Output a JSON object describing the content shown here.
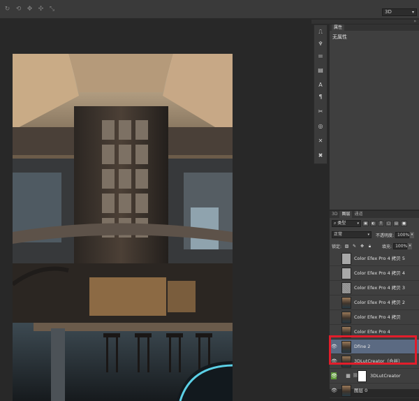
{
  "toolbar": {
    "icons": [
      "orbit-3d-icon",
      "roll-3d-icon",
      "pan-3d-icon",
      "slide-3d-icon",
      "scale-3d-icon"
    ],
    "mode_select": "3D"
  },
  "tool_strip": {
    "icons": [
      "history-brush-icon",
      "character-icon",
      "properties-sliders-icon",
      "adjust-icon",
      "text-icon",
      "paragraph-icon",
      "transform-icon",
      "path-icon",
      "tool-x-icon",
      "cross-tools-icon"
    ]
  },
  "properties_panel": {
    "tab_label": "属性",
    "title": "无属性"
  },
  "layers_panel": {
    "tabs": [
      "3D",
      "图层",
      "通道"
    ],
    "active_tab": "图层",
    "kind_filter": "类型",
    "blend_mode": "正常",
    "opacity_label": "不透明度:",
    "opacity_value": "100%",
    "lock_label": "锁定:",
    "fill_label": "填充:",
    "fill_value": "100%",
    "layers": [
      {
        "name": "Color Efex Pro 4 拷贝 5",
        "visible": false,
        "thumb": "gray"
      },
      {
        "name": "Color Efex Pro 4 拷贝 4",
        "visible": false,
        "thumb": "gray"
      },
      {
        "name": "Color Efex Pro 4 拷贝 3",
        "visible": false,
        "thumb": "noise"
      },
      {
        "name": "Color Efex Pro 4 拷贝 2",
        "visible": false,
        "thumb": "photo"
      },
      {
        "name": "Color Efex Pro 4 拷贝",
        "visible": false,
        "thumb": "photo"
      },
      {
        "name": "Color Efex Pro 4",
        "visible": false,
        "thumb": "photo"
      },
      {
        "name": "Dfine 2",
        "visible": true,
        "thumb": "photo",
        "selected": true
      },
      {
        "name": "3DLutCreator（合并）",
        "visible": true,
        "thumb": "photo"
      },
      {
        "name": "3DLutCreator",
        "visible": true,
        "adjustment": true
      },
      {
        "name": "图层 0",
        "visible": true,
        "thumb": "photo"
      }
    ]
  },
  "colors": {
    "highlight": "#e21d2b",
    "selected_layer": "#5b6a82",
    "visibility_green": "#5f9a39"
  }
}
